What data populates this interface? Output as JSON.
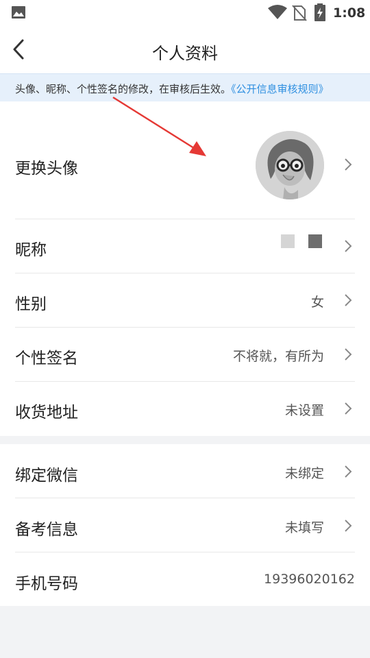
{
  "status_bar": {
    "time": "1:08",
    "icons": [
      "image-icon",
      "wifi-icon",
      "no-sim-icon",
      "battery-charging-icon"
    ]
  },
  "header": {
    "back_icon": "chevron-left-icon",
    "title": "个人资料"
  },
  "notice": {
    "text": "头像、昵称、个性签名的修改，在审核后生效。",
    "link": "《公开信息审核规则》",
    "link_color": "#2e8fe0",
    "background": "#e6f0fb"
  },
  "profile": {
    "avatar_label": "更换头像",
    "nickname_label": "昵称",
    "gender_label": "性别",
    "gender_value": "女",
    "signature_label": "个性签名",
    "signature_value": "不将就，有所为",
    "address_label": "收货地址",
    "address_value": "未设置"
  },
  "account": {
    "wechat_label": "绑定微信",
    "wechat_value": "未绑定",
    "exam_label": "备考信息",
    "exam_value": "未填写",
    "phone_label": "手机号码",
    "phone_value": "19396020162"
  },
  "annotation": {
    "arrow_color": "#e53935"
  }
}
